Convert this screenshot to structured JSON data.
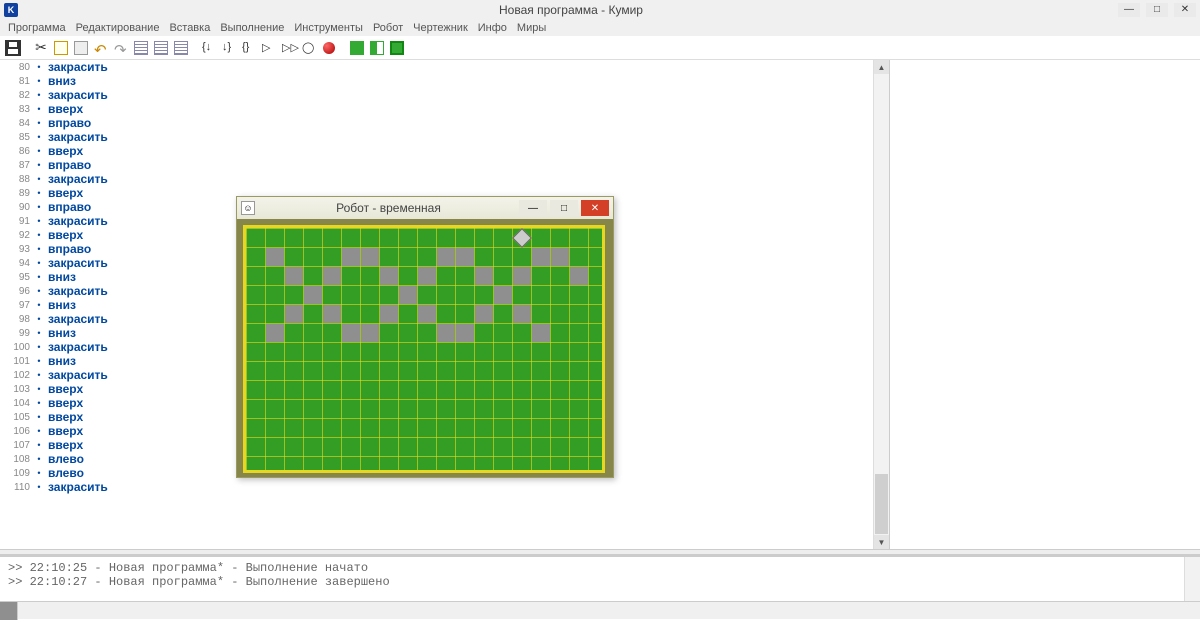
{
  "window": {
    "logo": "K",
    "title": "Новая программа - Кумир"
  },
  "menu": [
    "Программа",
    "Редактирование",
    "Вставка",
    "Выполнение",
    "Инструменты",
    "Робот",
    "Чертежник",
    "Инфо",
    "Миры"
  ],
  "code_start": 80,
  "code": [
    "закрасить",
    "вниз",
    "закрасить",
    "вверх",
    "вправо",
    "закрасить",
    "вверх",
    "вправо",
    "закрасить",
    "вверх",
    "вправо",
    "закрасить",
    "вверх",
    "вправо",
    "закрасить",
    "вниз",
    "закрасить",
    "вниз",
    "закрасить",
    "вниз",
    "закрасить",
    "вниз",
    "закрасить",
    "вверх",
    "вверх",
    "вверх",
    "вверх",
    "вверх",
    "влево",
    "влево",
    "закрасить"
  ],
  "console": [
    ">> 22:10:25 - Новая программа* - Выполнение начато",
    ">> 22:10:27 - Новая программа* - Выполнение завершено"
  ],
  "robot": {
    "title": "Робот - временная",
    "cols": 18,
    "rows": 12,
    "robot_pos": [
      14,
      0
    ],
    "filled": [
      [
        1,
        1
      ],
      [
        5,
        1
      ],
      [
        6,
        1
      ],
      [
        10,
        1
      ],
      [
        11,
        1
      ],
      [
        15,
        1
      ],
      [
        16,
        1
      ],
      [
        2,
        2
      ],
      [
        4,
        2
      ],
      [
        7,
        2
      ],
      [
        9,
        2
      ],
      [
        12,
        2
      ],
      [
        14,
        2
      ],
      [
        17,
        2
      ],
      [
        3,
        3
      ],
      [
        8,
        3
      ],
      [
        13,
        3
      ],
      [
        2,
        4
      ],
      [
        4,
        4
      ],
      [
        7,
        4
      ],
      [
        9,
        4
      ],
      [
        12,
        4
      ],
      [
        14,
        4
      ],
      [
        1,
        5
      ],
      [
        5,
        5
      ],
      [
        6,
        5
      ],
      [
        10,
        5
      ],
      [
        11,
        5
      ],
      [
        15,
        5
      ]
    ]
  }
}
